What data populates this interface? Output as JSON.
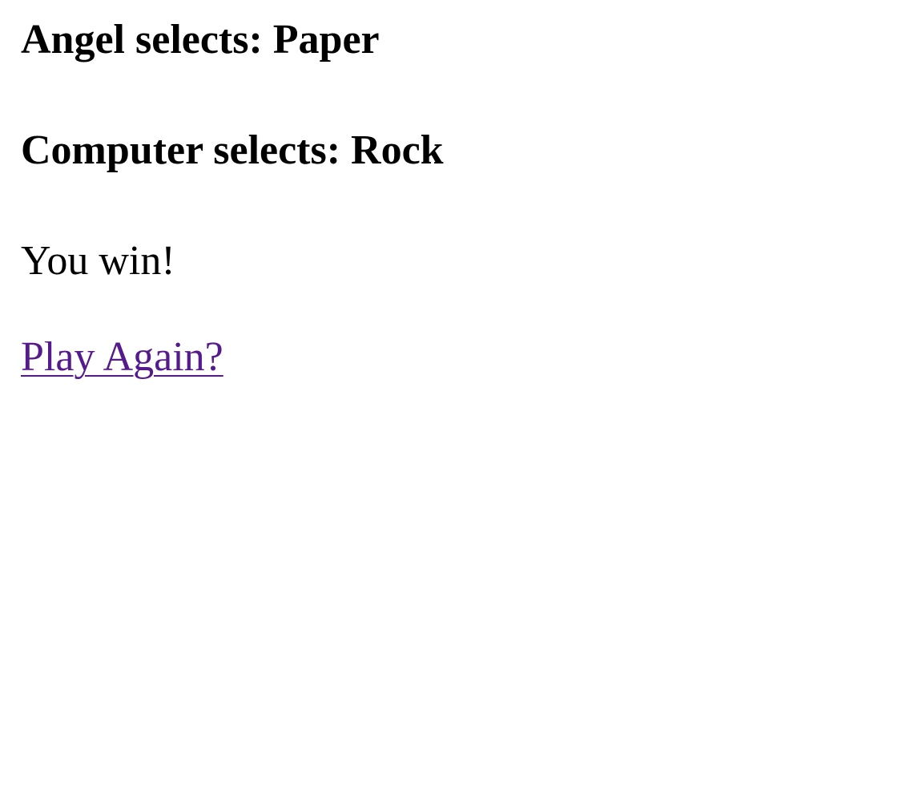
{
  "game": {
    "player_selection": "Angel selects: Paper",
    "computer_selection": "Computer selects: Rock",
    "result": "You win!",
    "play_again_label": "Play Again?"
  },
  "colors": {
    "text": "#000000",
    "visited_link": "#551a8b",
    "background": "#ffffff"
  }
}
